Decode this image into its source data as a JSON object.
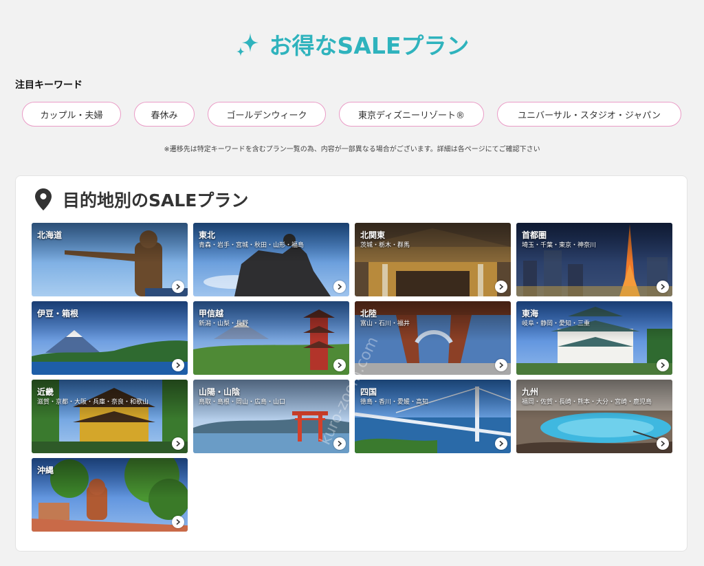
{
  "page": {
    "title": "お得なSALEプラン",
    "accent_color": "#2fb3bd",
    "sparkle_icon": "sparkle-icon"
  },
  "keywords": {
    "heading": "注目キーワード",
    "pill_border_color": "#ea9bc6",
    "items": [
      {
        "label": "カップル・夫婦"
      },
      {
        "label": "春休み"
      },
      {
        "label": "ゴールデンウィーク"
      },
      {
        "label": "東京ディズニーリゾート®"
      },
      {
        "label": "ユニバーサル・スタジオ・ジャパン"
      }
    ],
    "notice": "※遷移先は特定キーワードを含むプラン一覧の為、内容が一部異なる場合がございます。詳細は各ページにてご確認下さい"
  },
  "destinations": {
    "heading": "目的地別のSALEプラン",
    "pin_icon": "map-pin-icon",
    "watermark": "kuro-zoom.com",
    "regions": [
      {
        "name": "北海道",
        "prefectures": ""
      },
      {
        "name": "東北",
        "prefectures": "青森・岩手・宮城・秋田・山形・福島"
      },
      {
        "name": "北関東",
        "prefectures": "茨城・栃木・群馬"
      },
      {
        "name": "首都圏",
        "prefectures": "埼玉・千葉・東京・神奈川"
      },
      {
        "name": "伊豆・箱根",
        "prefectures": ""
      },
      {
        "name": "甲信越",
        "prefectures": "新潟・山梨・長野"
      },
      {
        "name": "北陸",
        "prefectures": "富山・石川・福井"
      },
      {
        "name": "東海",
        "prefectures": "岐阜・静岡・愛知・三重"
      },
      {
        "name": "近畿",
        "prefectures": "滋賀・京都・大阪・兵庫・奈良・和歌山"
      },
      {
        "name": "山陽・山陰",
        "prefectures": "鳥取・島根・岡山・広島・山口"
      },
      {
        "name": "四国",
        "prefectures": "徳島・香川・愛媛・高知"
      },
      {
        "name": "九州",
        "prefectures": "福岡・佐賀・長崎・熊本・大分・宮崎・鹿児島"
      },
      {
        "name": "沖縄",
        "prefectures": ""
      }
    ]
  }
}
